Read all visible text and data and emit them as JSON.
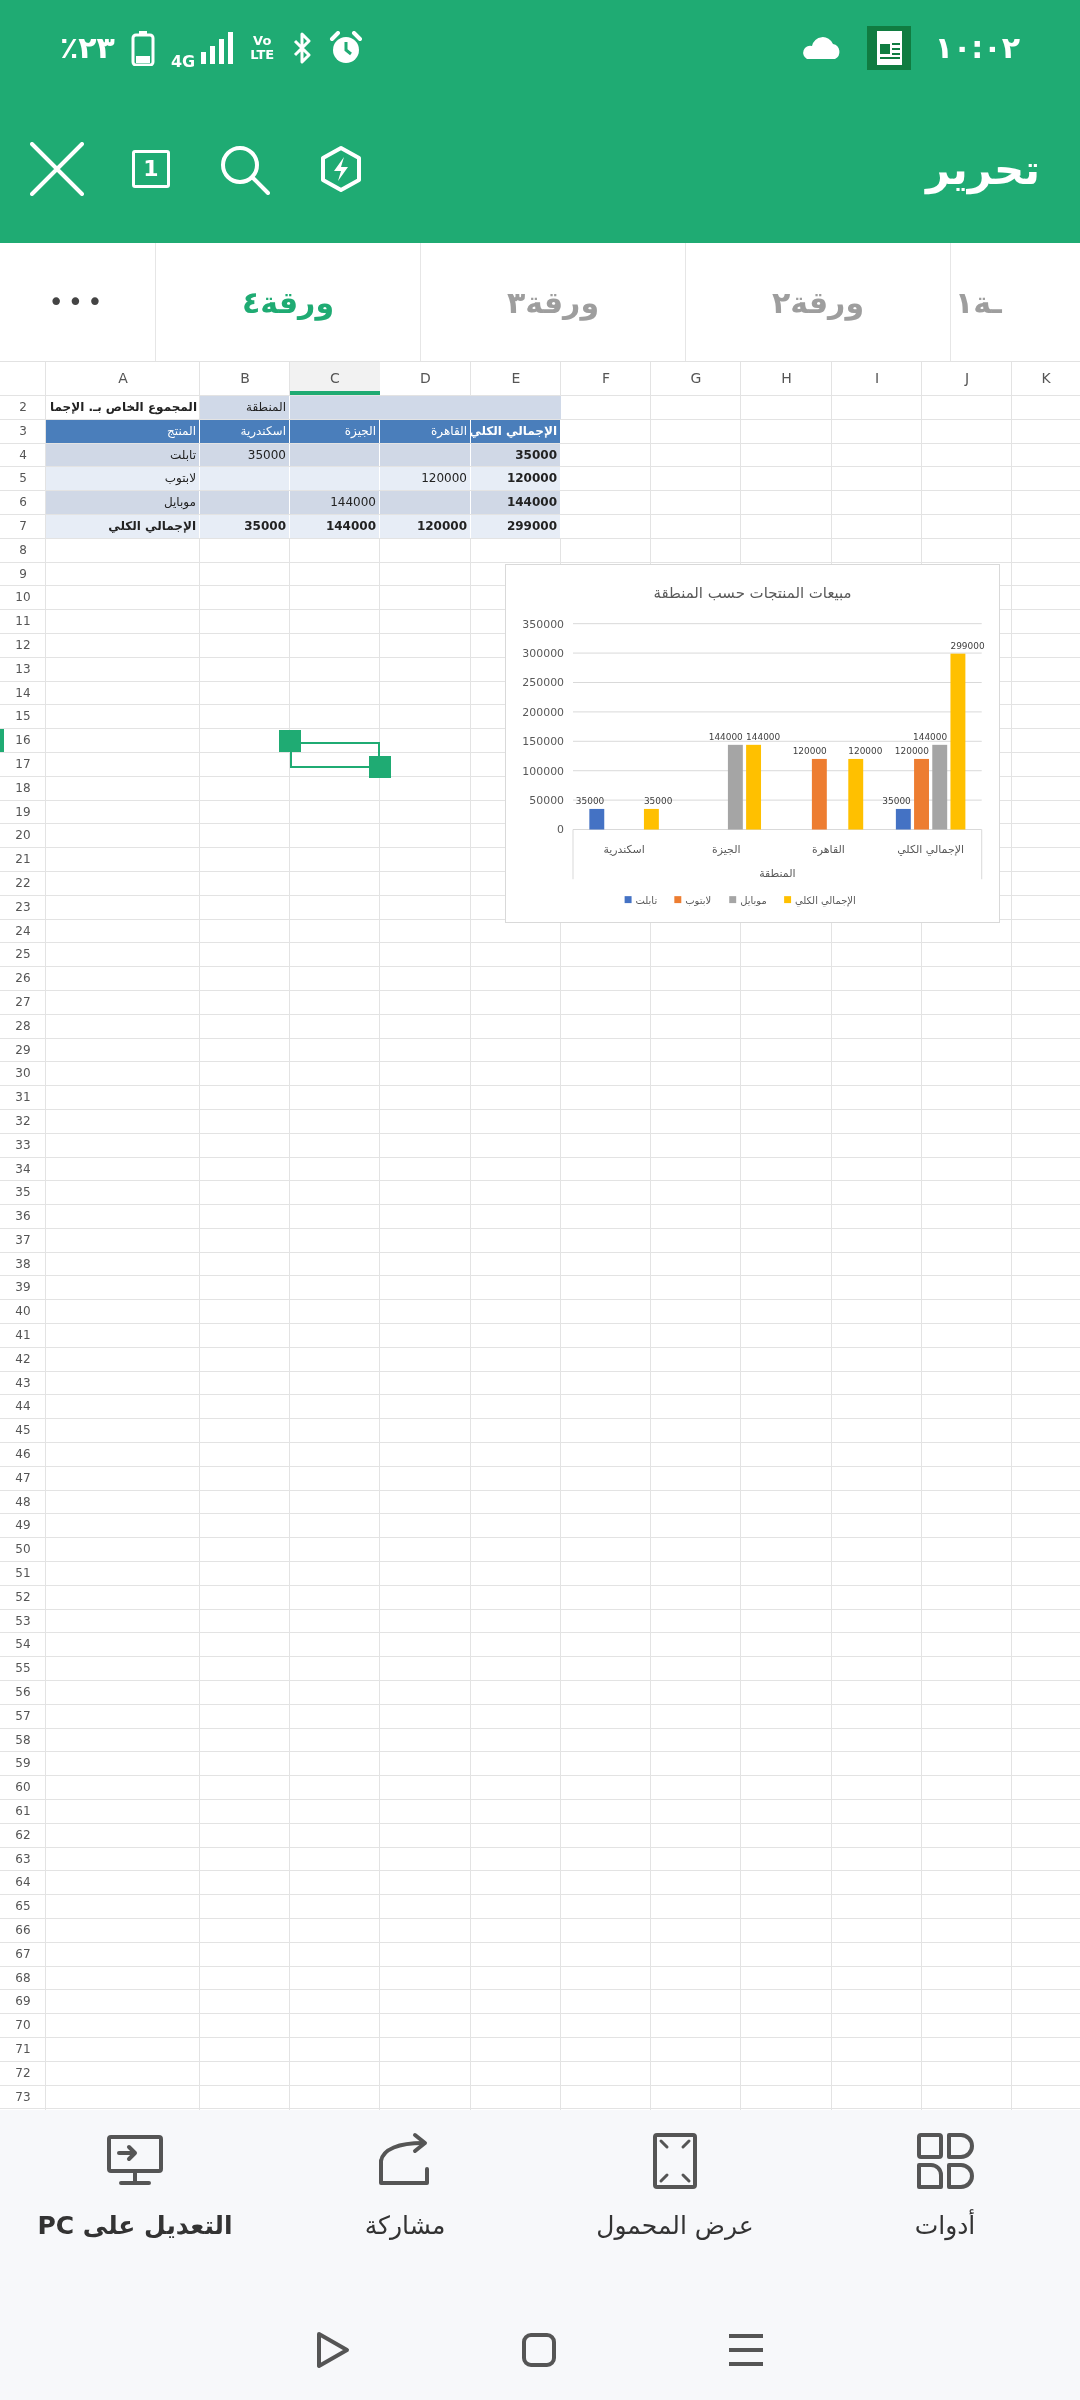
{
  "status_bar": {
    "battery": "٪٢٣",
    "network": "4G",
    "volte": "Vo LTE",
    "time": "١٠:٠٢"
  },
  "toolbar": {
    "page_count": "1",
    "title": "تحرير"
  },
  "sheet_tabs": [
    {
      "label": "ـة١",
      "selected": false
    },
    {
      "label": "ورقة٢",
      "selected": false
    },
    {
      "label": "ورقة٣",
      "selected": false
    },
    {
      "label": "ورقة٤",
      "selected": true
    }
  ],
  "more_button": {
    "label": "•••"
  },
  "sheet": {
    "columns": [
      {
        "label": "K",
        "selected": false
      },
      {
        "label": "J",
        "selected": false
      },
      {
        "label": "I",
        "selected": false
      },
      {
        "label": "H",
        "selected": false
      },
      {
        "label": "G",
        "selected": false
      },
      {
        "label": "F",
        "selected": false
      },
      {
        "label": "E",
        "selected": false
      },
      {
        "label": "D",
        "selected": false
      },
      {
        "label": "C",
        "selected": true
      },
      {
        "label": "B",
        "selected": false
      },
      {
        "label": "A",
        "selected": false
      }
    ],
    "rows": [
      {
        "number": "2",
        "selected": false,
        "kind": "filter",
        "cells": [
          null,
          null,
          null,
          {
            "text": "المنطقة",
            "bold": false
          },
          {
            "text": "المجموع الخاص بـ. الإجما",
            "bold": true
          }
        ]
      },
      {
        "number": "3",
        "selected": false,
        "kind": "header",
        "cells": [
          {
            "text": "الإجمالي الكلي",
            "bold": true
          },
          {
            "text": "القاهرة",
            "bold": false
          },
          {
            "text": "الجيزة",
            "bold": false
          },
          {
            "text": "اسكندرية",
            "bold": false
          },
          {
            "text": "المنتج",
            "bold": false
          }
        ]
      },
      {
        "number": "4",
        "selected": false,
        "kind": "band_dark",
        "cells": [
          {
            "text": "35000",
            "bold": true
          },
          null,
          null,
          {
            "text": "35000",
            "bold": false
          },
          {
            "text": "تابلت",
            "bold": false
          }
        ]
      },
      {
        "number": "5",
        "selected": false,
        "kind": "band_light",
        "cells": [
          {
            "text": "120000",
            "bold": true
          },
          {
            "text": "120000",
            "bold": false
          },
          null,
          null,
          {
            "text": "لابتوب",
            "bold": false
          }
        ]
      },
      {
        "number": "6",
        "selected": false,
        "kind": "band_dark",
        "cells": [
          {
            "text": "144000",
            "bold": true
          },
          null,
          {
            "text": "144000",
            "bold": false
          },
          null,
          {
            "text": "موبايل",
            "bold": false
          }
        ]
      },
      {
        "number": "7",
        "selected": false,
        "kind": "band_light",
        "cells": [
          {
            "text": "299000",
            "bold": true
          },
          {
            "text": "120000",
            "bold": true
          },
          {
            "text": "144000",
            "bold": true
          },
          {
            "text": "35000",
            "bold": true
          },
          {
            "text": "الإجمالي الكلي",
            "bold": true
          }
        ]
      },
      {
        "number": "8",
        "selected": false
      },
      {
        "number": "9",
        "selected": false
      },
      {
        "number": "10",
        "selected": false
      },
      {
        "number": "11",
        "selected": false
      },
      {
        "number": "12",
        "selected": false
      },
      {
        "number": "13",
        "selected": false
      },
      {
        "number": "14",
        "selected": false
      },
      {
        "number": "15",
        "selected": false
      },
      {
        "number": "16",
        "selected": true
      },
      {
        "number": "17",
        "selected": false
      },
      {
        "number": "18",
        "selected": false
      },
      {
        "number": "19",
        "selected": false
      },
      {
        "number": "20",
        "selected": false
      },
      {
        "number": "21",
        "selected": false
      },
      {
        "number": "22",
        "selected": false
      },
      {
        "number": "23",
        "selected": false
      },
      {
        "number": "24",
        "selected": false
      },
      {
        "number": "25",
        "selected": false
      },
      {
        "number": "26",
        "selected": false
      },
      {
        "number": "27",
        "selected": false
      },
      {
        "number": "28",
        "selected": false
      },
      {
        "number": "29",
        "selected": false
      },
      {
        "number": "30",
        "selected": false
      },
      {
        "number": "31",
        "selected": false
      },
      {
        "number": "32",
        "selected": false
      },
      {
        "number": "33",
        "selected": false
      },
      {
        "number": "34",
        "selected": false
      },
      {
        "number": "35",
        "selected": false
      },
      {
        "number": "36",
        "selected": false
      },
      {
        "number": "37",
        "selected": false
      },
      {
        "number": "38",
        "selected": false
      },
      {
        "number": "39",
        "selected": false
      },
      {
        "number": "40",
        "selected": false
      },
      {
        "number": "41",
        "selected": false
      },
      {
        "number": "42",
        "selected": false
      },
      {
        "number": "43",
        "selected": false
      },
      {
        "number": "44",
        "selected": false
      },
      {
        "number": "45",
        "selected": false
      },
      {
        "number": "46",
        "selected": false
      },
      {
        "number": "47",
        "selected": false
      },
      {
        "number": "48",
        "selected": false
      },
      {
        "number": "49",
        "selected": false
      },
      {
        "number": "50",
        "selected": false
      },
      {
        "number": "51",
        "selected": false
      },
      {
        "number": "52",
        "selected": false
      },
      {
        "number": "53",
        "selected": false
      },
      {
        "number": "54",
        "selected": false
      },
      {
        "number": "55",
        "selected": false
      },
      {
        "number": "56",
        "selected": false
      },
      {
        "number": "57",
        "selected": false
      },
      {
        "number": "58",
        "selected": false
      },
      {
        "number": "59",
        "selected": false
      },
      {
        "number": "60",
        "selected": false
      },
      {
        "number": "61",
        "selected": false
      },
      {
        "number": "62",
        "selected": false
      },
      {
        "number": "63",
        "selected": false
      },
      {
        "number": "64",
        "selected": false
      },
      {
        "number": "65",
        "selected": false
      },
      {
        "number": "66",
        "selected": false
      },
      {
        "number": "67",
        "selected": false
      },
      {
        "number": "68",
        "selected": false
      },
      {
        "number": "69",
        "selected": false
      },
      {
        "number": "70",
        "selected": false
      },
      {
        "number": "71",
        "selected": false
      },
      {
        "number": "72",
        "selected": false
      },
      {
        "number": "73",
        "selected": false
      }
    ],
    "chart": {
      "chart_data": {
        "type": "bar",
        "title": "مبيعات المنتجات حسب المنطقة",
        "xlabel": "المنطقة",
        "categories": [
          "اسكندرية",
          "الجيزة",
          "القاهرة",
          "الإجمالي الكلي"
        ],
        "series": [
          {
            "name": "تابلت",
            "color": "#4472c4",
            "values": [
              35000,
              null,
              null,
              35000
            ],
            "value_labels": [
              "35000",
              null,
              null,
              "35000"
            ]
          },
          {
            "name": "لابتوب",
            "color": "#ed7d31",
            "values": [
              null,
              null,
              120000,
              120000
            ],
            "value_labels": [
              null,
              null,
              "120000",
              "120000"
            ]
          },
          {
            "name": "موبايل",
            "color": "#a5a5a5",
            "values": [
              null,
              144000,
              null,
              144000
            ],
            "value_labels": [
              null,
              "144000",
              null,
              "144000"
            ]
          },
          {
            "name": "الإجمالي الكلي",
            "color": "#ffc000",
            "values": [
              35000,
              144000,
              120000,
              299000
            ],
            "value_labels": [
              "35000",
              "144000",
              "120000",
              "299000"
            ]
          }
        ],
        "ylim": [
          0,
          350000
        ],
        "yticks": [
          0,
          50000,
          100000,
          150000,
          200000,
          250000,
          300000,
          350000
        ],
        "grid": true,
        "legend": "bottom"
      }
    }
  },
  "bottom_bar": [
    {
      "kind": "tools",
      "label": "أدوات"
    },
    {
      "kind": "mobile_view",
      "label": "عرض المحمول"
    },
    {
      "kind": "share",
      "label": "مشاركة"
    },
    {
      "kind": "edit_pc",
      "label": "التعديل على PC"
    }
  ]
}
